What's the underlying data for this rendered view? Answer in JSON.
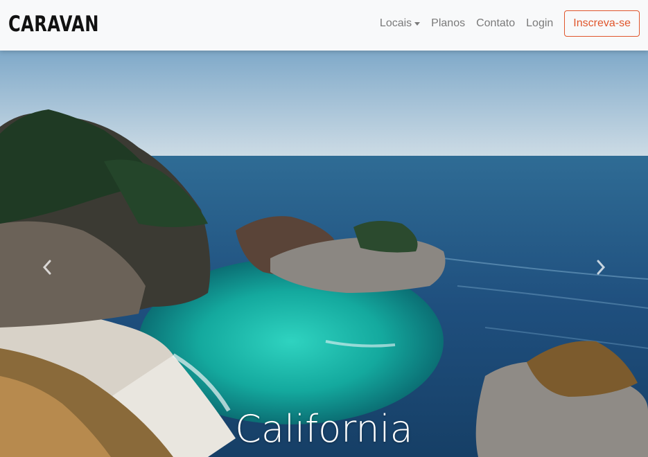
{
  "navbar": {
    "brand": "CARAVAN",
    "links": [
      {
        "label": "Locais",
        "dropdown": true
      },
      {
        "label": "Planos"
      },
      {
        "label": "Contato"
      },
      {
        "label": "Login"
      }
    ],
    "signup_label": "Inscreva-se"
  },
  "carousel": {
    "caption": "California",
    "prev_icon": "chevron-left-icon",
    "next_icon": "chevron-right-icon"
  },
  "colors": {
    "navbar_bg": "#f8f9fa",
    "accent": "#e0552b",
    "nav_text": "#7a7a7a"
  }
}
